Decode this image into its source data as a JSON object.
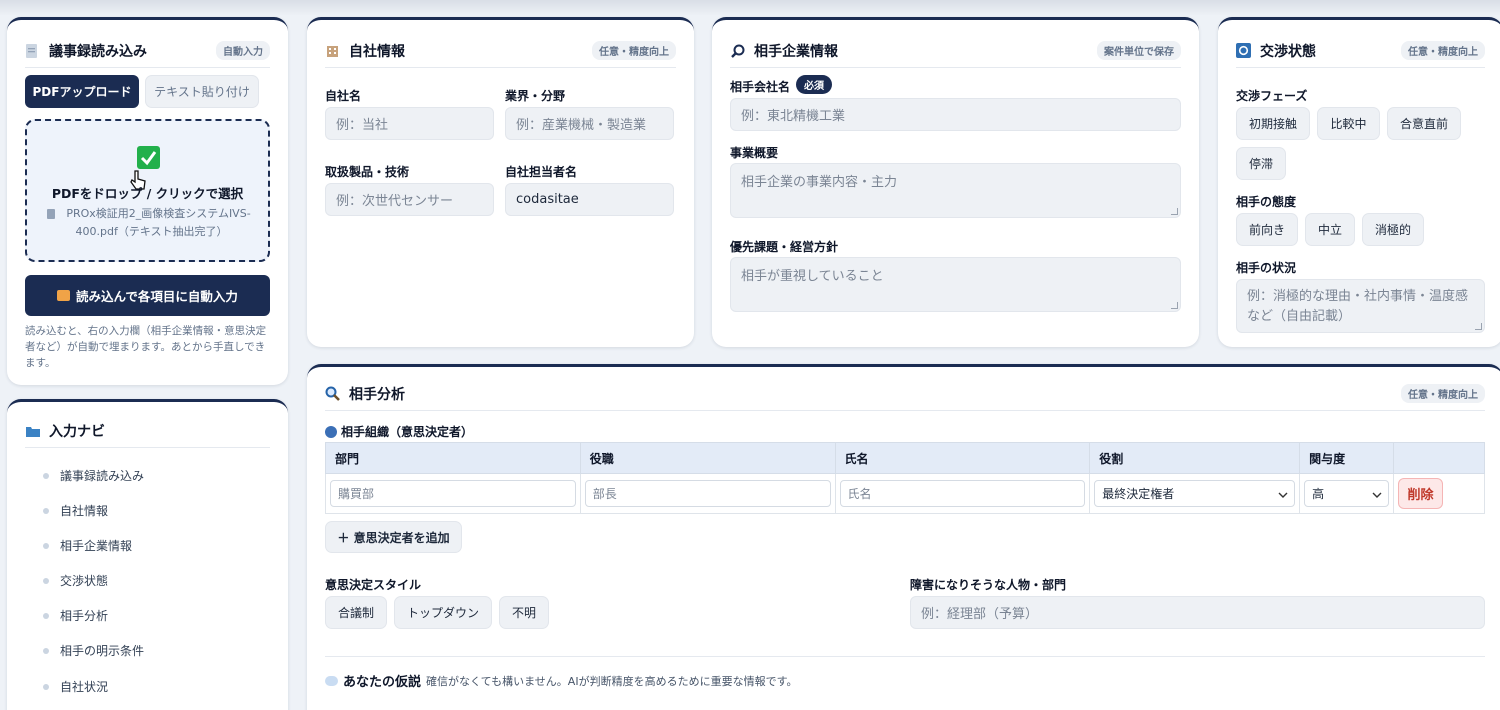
{
  "minutes_card": {
    "title": "議事録読み込み",
    "tag": "自動入力",
    "tabs": [
      "PDFアップロード",
      "テキスト貼り付け"
    ],
    "drop_text": "PDFをドロップ / クリックで選択",
    "file_info": "PROx検証用2_画像検査システムIVS-400.pdf（テキスト抽出完了）",
    "import_button": "読み込んで各項目に自動入力",
    "help_text": "読み込むと、右の入力欄（相手企業情報・意思決定者など）が自動で埋まります。あとから手直しできます。"
  },
  "nav_card": {
    "title": "入力ナビ",
    "items": [
      "議事録読み込み",
      "自社情報",
      "相手企業情報",
      "交渉状態",
      "相手分析",
      "相手の明示条件",
      "自社状況"
    ]
  },
  "own_company": {
    "title": "自社情報",
    "tag": "任意・精度向上",
    "fields": {
      "name_label": "自社名",
      "name_placeholder": "例：当社",
      "industry_label": "業界・分野",
      "industry_placeholder": "例：産業機械・製造業",
      "products_label": "取扱製品・技術",
      "products_placeholder": "例：次世代センサー",
      "owner_label": "自社担当者名",
      "owner_value": "codasitae"
    }
  },
  "partner_company": {
    "title": "相手企業情報",
    "tag": "案件単位で保存",
    "name_label": "相手会社名",
    "required": "必須",
    "name_placeholder": "例：東北精機工業",
    "summary_label": "事業概要",
    "summary_placeholder": "相手企業の事業内容・主力",
    "priority_label": "優先課題・経営方針",
    "priority_placeholder": "相手が重視していること"
  },
  "negotiation": {
    "title": "交渉状態",
    "tag": "任意・精度向上",
    "phase_label": "交渉フェーズ",
    "phases": [
      "初期接触",
      "比較中",
      "合意直前",
      "停滞"
    ],
    "attitude_label": "相手の態度",
    "attitudes": [
      "前向き",
      "中立",
      "消極的"
    ],
    "situation_label": "相手の状況",
    "situation_placeholder": "例：消極的な理由・社内事情・温度感など（自由記載）"
  },
  "analysis": {
    "title": "相手分析",
    "tag": "任意・精度向上",
    "org_label": "相手組織（意思決定者）",
    "columns": [
      "部門",
      "役職",
      "氏名",
      "役割",
      "関与度"
    ],
    "row": {
      "dept_placeholder": "購買部",
      "title_placeholder": "部長",
      "name_placeholder": "氏名",
      "role_value": "最終決定権者",
      "involvement_value": "高",
      "delete_label": "削除"
    },
    "add_button": "＋ 意思決定者を追加",
    "style_label": "意思決定スタイル",
    "styles": [
      "合議制",
      "トップダウン",
      "不明"
    ],
    "obstacle_label": "障害になりそうな人物・部門",
    "obstacle_placeholder": "例：経理部（予算）",
    "hypothesis_title": "あなたの仮説",
    "hypothesis_note": "確信がなくても構いません。AIが判断精度を高めるために重要な情報です。"
  }
}
